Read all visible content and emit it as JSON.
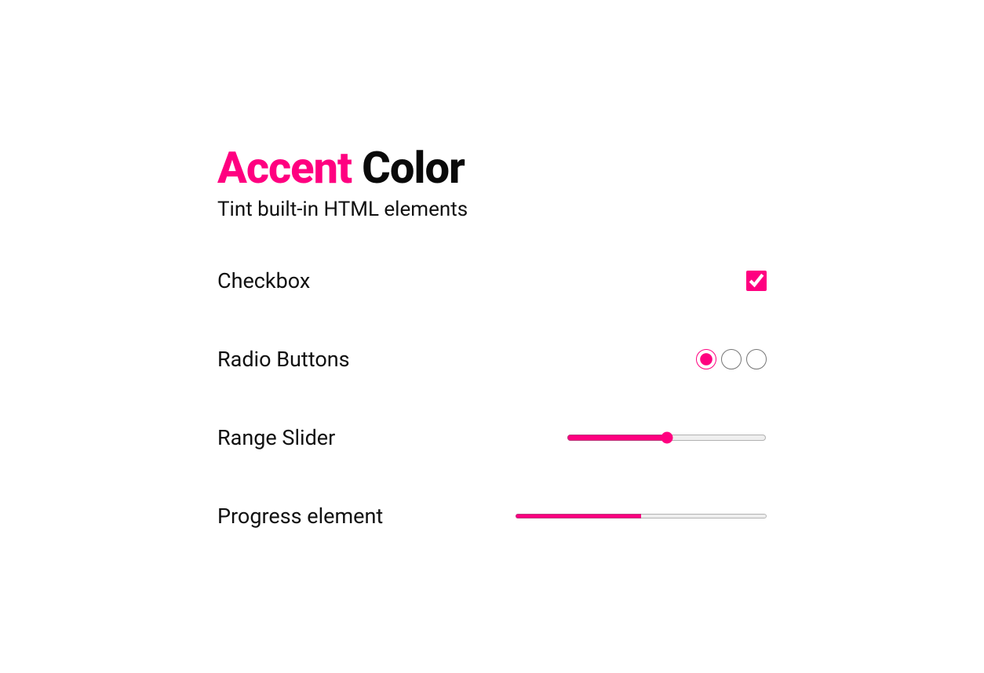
{
  "heading": {
    "accent_word": "Accent",
    "rest": " Color"
  },
  "subtitle": "Tint built-in HTML elements",
  "rows": {
    "checkbox": {
      "label": "Checkbox",
      "checked": true
    },
    "radio": {
      "label": "Radio Buttons",
      "selected_index": 0,
      "count": 3
    },
    "range": {
      "label": "Range Slider",
      "value": 50,
      "min": 0,
      "max": 100
    },
    "progress": {
      "label": "Progress element",
      "value": 50,
      "max": 100
    }
  },
  "accent_color": "#ff0080"
}
